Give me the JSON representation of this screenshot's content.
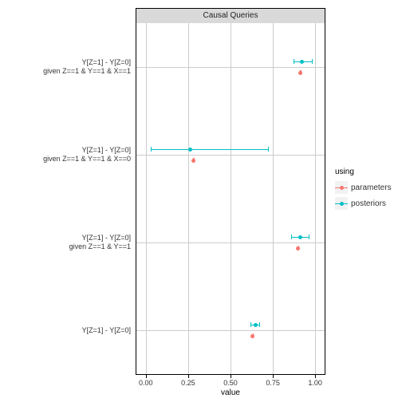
{
  "chart_data": {
    "type": "pointrange",
    "facet_title": "Causal Queries",
    "xlabel": "value",
    "xlim": [
      0.0,
      1.0
    ],
    "xticks": [
      0.0,
      0.25,
      0.5,
      0.75,
      1.0
    ],
    "categories": [
      "Y[Z=1] - Y[Z=0]",
      "Y[Z=1] - Y[Z=0]\ngiven Z==1 & Y==1",
      "Y[Z=1] - Y[Z=0]\ngiven Z==1 & Y==1 & X==0",
      "Y[Z=1] - Y[Z=0]\ngiven Z==1 & Y==1 & X==1"
    ],
    "series": [
      {
        "name": "parameters",
        "color": "#F8766D",
        "offset": 1,
        "points": [
          {
            "cat": 0,
            "mid": 0.63,
            "low": 0.63,
            "high": 0.63
          },
          {
            "cat": 1,
            "mid": 0.9,
            "low": 0.9,
            "high": 0.9
          },
          {
            "cat": 2,
            "mid": 0.28,
            "low": 0.28,
            "high": 0.28
          },
          {
            "cat": 3,
            "mid": 0.91,
            "low": 0.91,
            "high": 0.91
          }
        ]
      },
      {
        "name": "posteriors",
        "color": "#00BFC4",
        "offset": -1,
        "points": [
          {
            "cat": 0,
            "mid": 0.65,
            "low": 0.62,
            "high": 0.67
          },
          {
            "cat": 1,
            "mid": 0.91,
            "low": 0.86,
            "high": 0.96
          },
          {
            "cat": 2,
            "mid": 0.26,
            "low": 0.03,
            "high": 0.72
          },
          {
            "cat": 3,
            "mid": 0.92,
            "low": 0.87,
            "high": 0.98
          }
        ]
      }
    ],
    "legend_title": "using"
  }
}
